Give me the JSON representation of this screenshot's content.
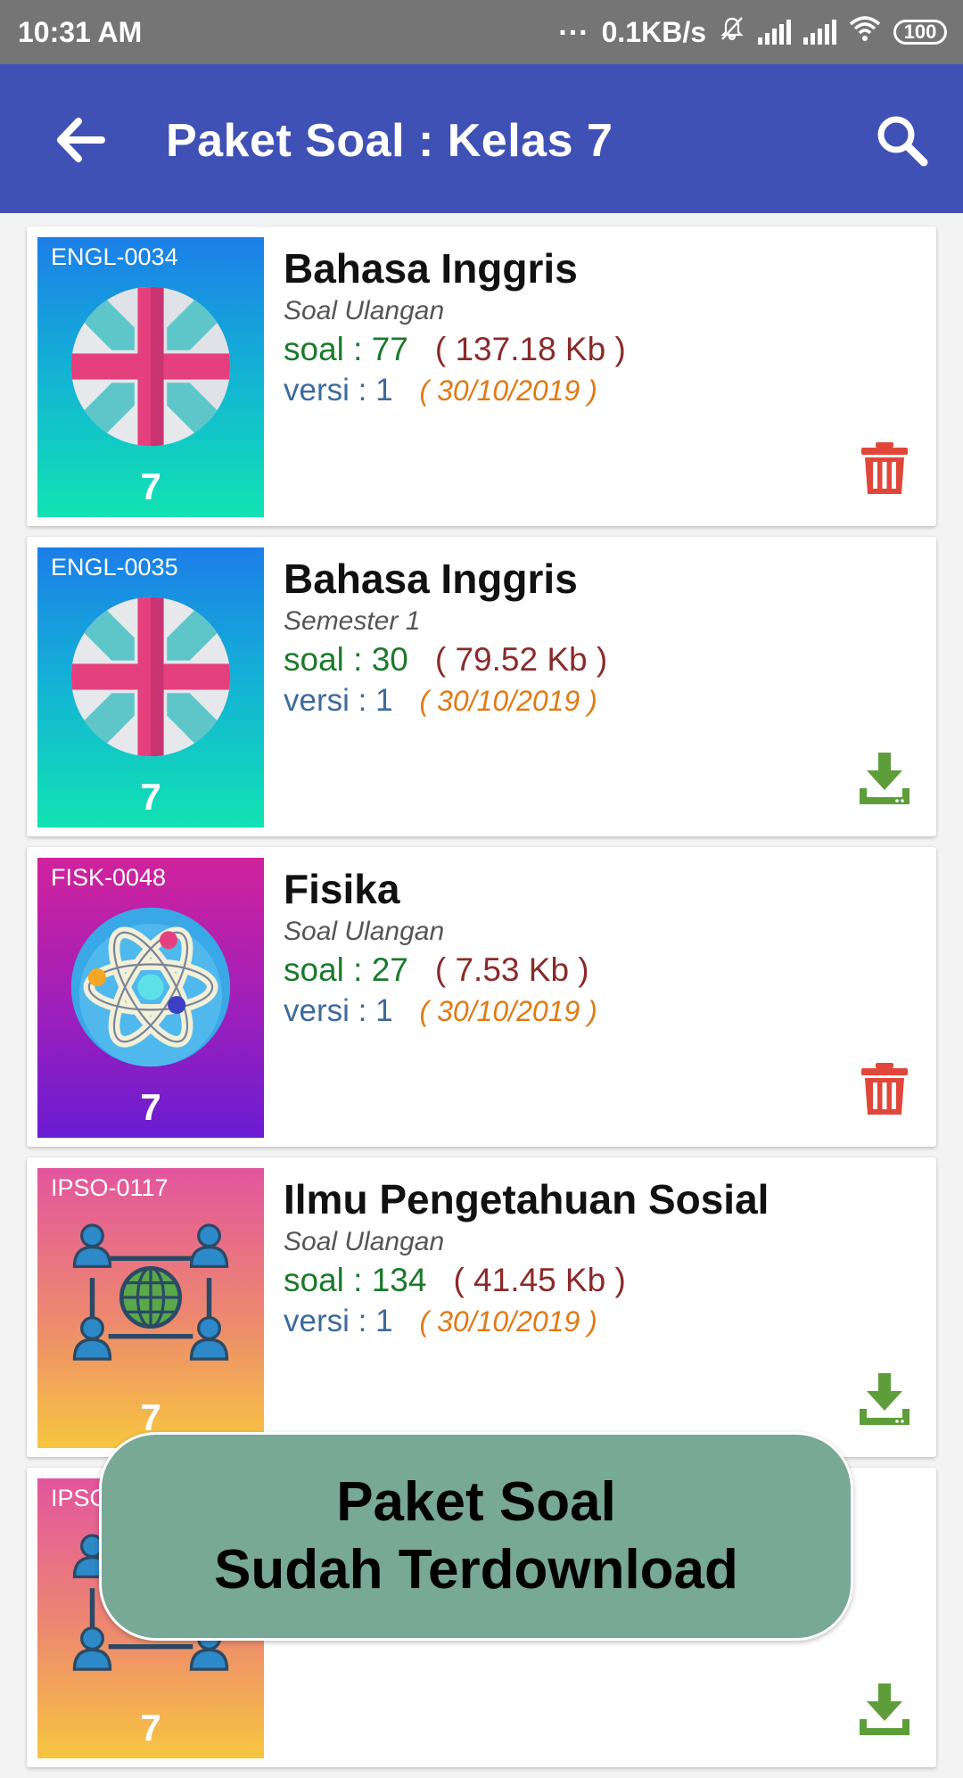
{
  "status_bar": {
    "time": "10:31 AM",
    "dots": "...",
    "net_speed": "0.1KB/s",
    "battery": "100"
  },
  "app_bar": {
    "title": "Paket Soal : Kelas 7",
    "back_icon": "arrow-left-icon",
    "search_icon": "search-icon",
    "color": "#3f51b5"
  },
  "items": [
    {
      "code": "ENGL-0034",
      "grade": "7",
      "title": "Bahasa Inggris",
      "subtitle": "Soal Ulangan",
      "soal": "soal : 77",
      "size": "( 137.18 Kb )",
      "versi": "versi : 1",
      "date": "( 30/10/2019 )",
      "icon": "uk-flag-icon",
      "action": "delete"
    },
    {
      "code": "ENGL-0035",
      "grade": "7",
      "title": "Bahasa Inggris",
      "subtitle": "Semester 1",
      "soal": "soal : 30",
      "size": "( 79.52 Kb )",
      "versi": "versi : 1",
      "date": "( 30/10/2019 )",
      "icon": "uk-flag-icon",
      "action": "download"
    },
    {
      "code": "FISK-0048",
      "grade": "7",
      "title": "Fisika",
      "subtitle": "Soal Ulangan",
      "soal": "soal : 27",
      "size": "( 7.53 Kb )",
      "versi": "versi : 1",
      "date": "( 30/10/2019 )",
      "icon": "atom-icon",
      "action": "delete"
    },
    {
      "code": "IPSO-0117",
      "grade": "7",
      "title": "Ilmu Pengetahuan Sosial",
      "subtitle": "Soal Ulangan",
      "soal": "soal : 134",
      "size": "( 41.45 Kb )",
      "versi": "versi : 1",
      "date": "( 30/10/2019 )",
      "icon": "global-network-icon",
      "action": "download"
    },
    {
      "code": "IPSO",
      "grade": "7",
      "title": "",
      "subtitle": "",
      "icon": "global-network-icon",
      "action": "download"
    }
  ],
  "toast": {
    "line1": "Paket Soal",
    "line2": "Sudah Terdownload"
  },
  "colors": {
    "delete": "#e0473a",
    "download": "#5d9e3a",
    "soal": "#1b7a2a",
    "size": "#8b2a2a",
    "versi": "#3d6a9c",
    "date": "#e07a14"
  }
}
